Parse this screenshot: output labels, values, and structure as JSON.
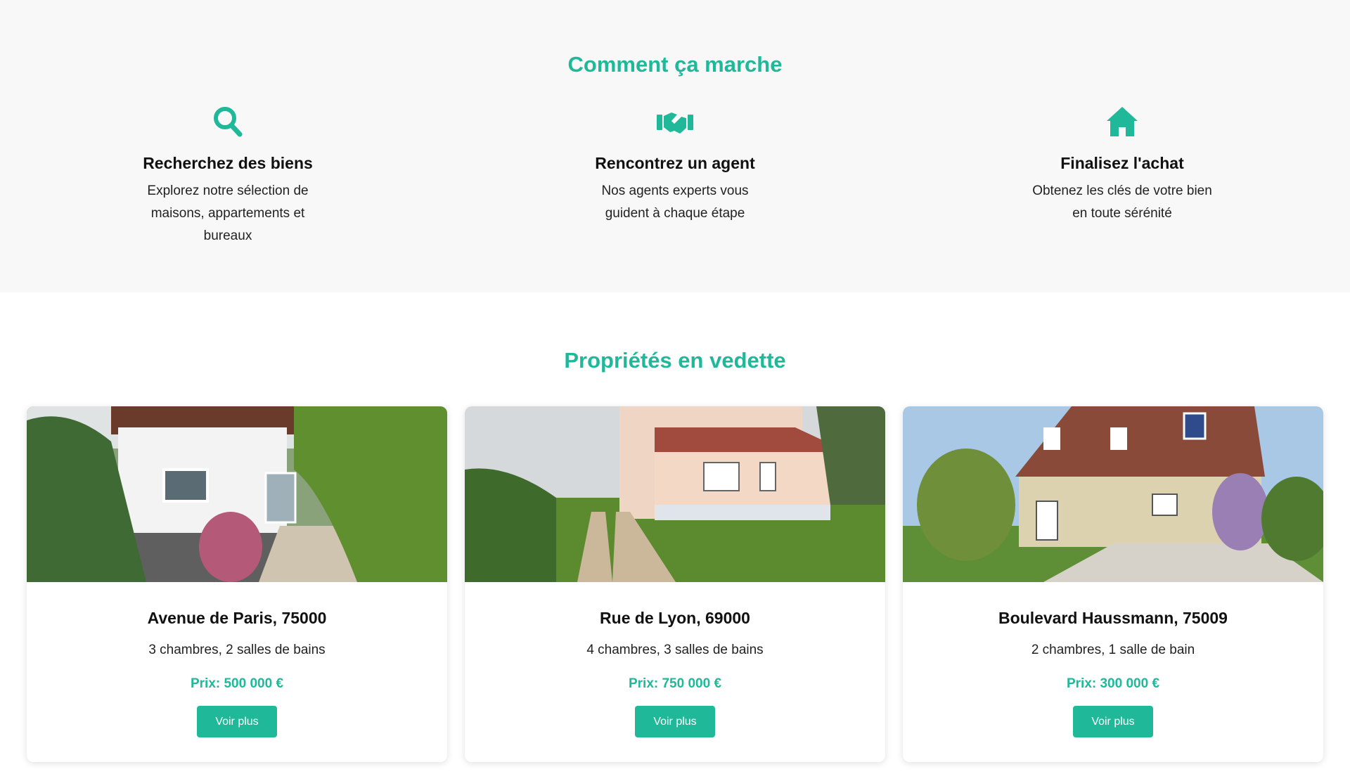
{
  "how_it_works": {
    "title": "Comment ça marche",
    "steps": [
      {
        "icon": "search-icon",
        "title": "Recherchez des biens",
        "text": "Explorez notre sélection de maisons, appartements et bureaux"
      },
      {
        "icon": "handshake-icon",
        "title": "Rencontrez un agent",
        "text": "Nos agents experts vous guident à chaque étape"
      },
      {
        "icon": "home-icon",
        "title": "Finalisez l'achat",
        "text": "Obtenez les clés de votre bien en toute sérénité"
      }
    ]
  },
  "featured": {
    "title": "Propriétés en vedette",
    "properties": [
      {
        "address": "Avenue de Paris, 75000",
        "rooms": "3 chambres, 2 salles de bains",
        "price": "Prix: 500 000 €",
        "button": "Voir plus"
      },
      {
        "address": "Rue de Lyon, 69000",
        "rooms": "4 chambres, 3 salles de bains",
        "price": "Prix: 750 000 €",
        "button": "Voir plus"
      },
      {
        "address": "Boulevard Haussmann, 75009",
        "rooms": "2 chambres, 1 salle de bain",
        "price": "Prix: 300 000 €",
        "button": "Voir plus"
      }
    ]
  },
  "colors": {
    "accent": "#1fb99a",
    "section_bg": "#f8f8f8"
  }
}
